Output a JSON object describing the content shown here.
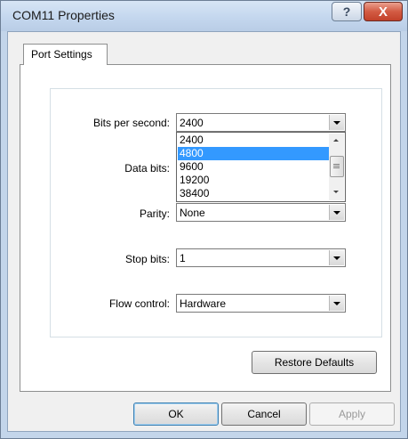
{
  "window": {
    "title": "COM11 Properties",
    "help_glyph": "?",
    "close_glyph": "X"
  },
  "tabs": [
    {
      "label": "Port Settings"
    }
  ],
  "fields": {
    "bits_per_second": {
      "label": "Bits per second:",
      "value": "2400"
    },
    "data_bits": {
      "label": "Data bits:"
    },
    "parity": {
      "label": "Parity:",
      "value": "None"
    },
    "stop_bits": {
      "label": "Stop bits:",
      "value": "1"
    },
    "flow_control": {
      "label": "Flow control:",
      "value": "Hardware"
    }
  },
  "dropdown": {
    "options": [
      "2400",
      "4800",
      "9600",
      "19200",
      "38400"
    ],
    "selected": "4800"
  },
  "buttons": {
    "restore_defaults": "Restore Defaults",
    "ok": "OK",
    "cancel": "Cancel",
    "apply": "Apply"
  }
}
